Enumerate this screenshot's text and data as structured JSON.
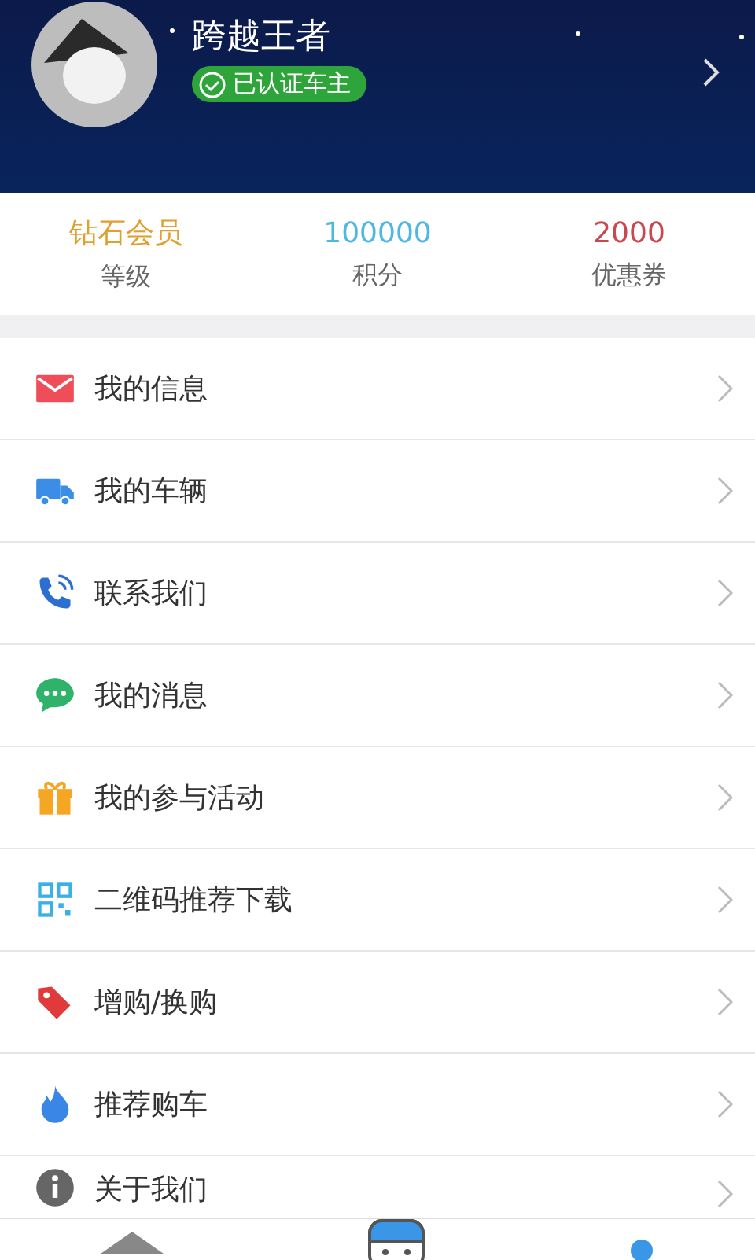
{
  "profile": {
    "name": "跨越王者",
    "badge": "已认证车主"
  },
  "stats": [
    {
      "value": "钻石会员",
      "label": "等级",
      "color": "#e0a030"
    },
    {
      "value": "100000",
      "label": "积分",
      "color": "#4fb8e0"
    },
    {
      "value": "2000",
      "label": "优惠券",
      "color": "#c9474f"
    }
  ],
  "menu": [
    {
      "kind": "mail",
      "label": "我的信息"
    },
    {
      "kind": "truck",
      "label": "我的车辆"
    },
    {
      "kind": "phone",
      "label": "联系我们"
    },
    {
      "kind": "chat",
      "label": "我的消息"
    },
    {
      "kind": "gift",
      "label": "我的参与活动"
    },
    {
      "kind": "qr",
      "label": "二维码推荐下载"
    },
    {
      "kind": "tag",
      "label": "增购/换购"
    },
    {
      "kind": "flame",
      "label": "推荐购车"
    },
    {
      "kind": "info",
      "label": "关于我们"
    }
  ],
  "nav": [
    {
      "kind": "home",
      "selected": false
    },
    {
      "kind": "robot",
      "selected": false
    },
    {
      "kind": "profile",
      "selected": true
    }
  ]
}
